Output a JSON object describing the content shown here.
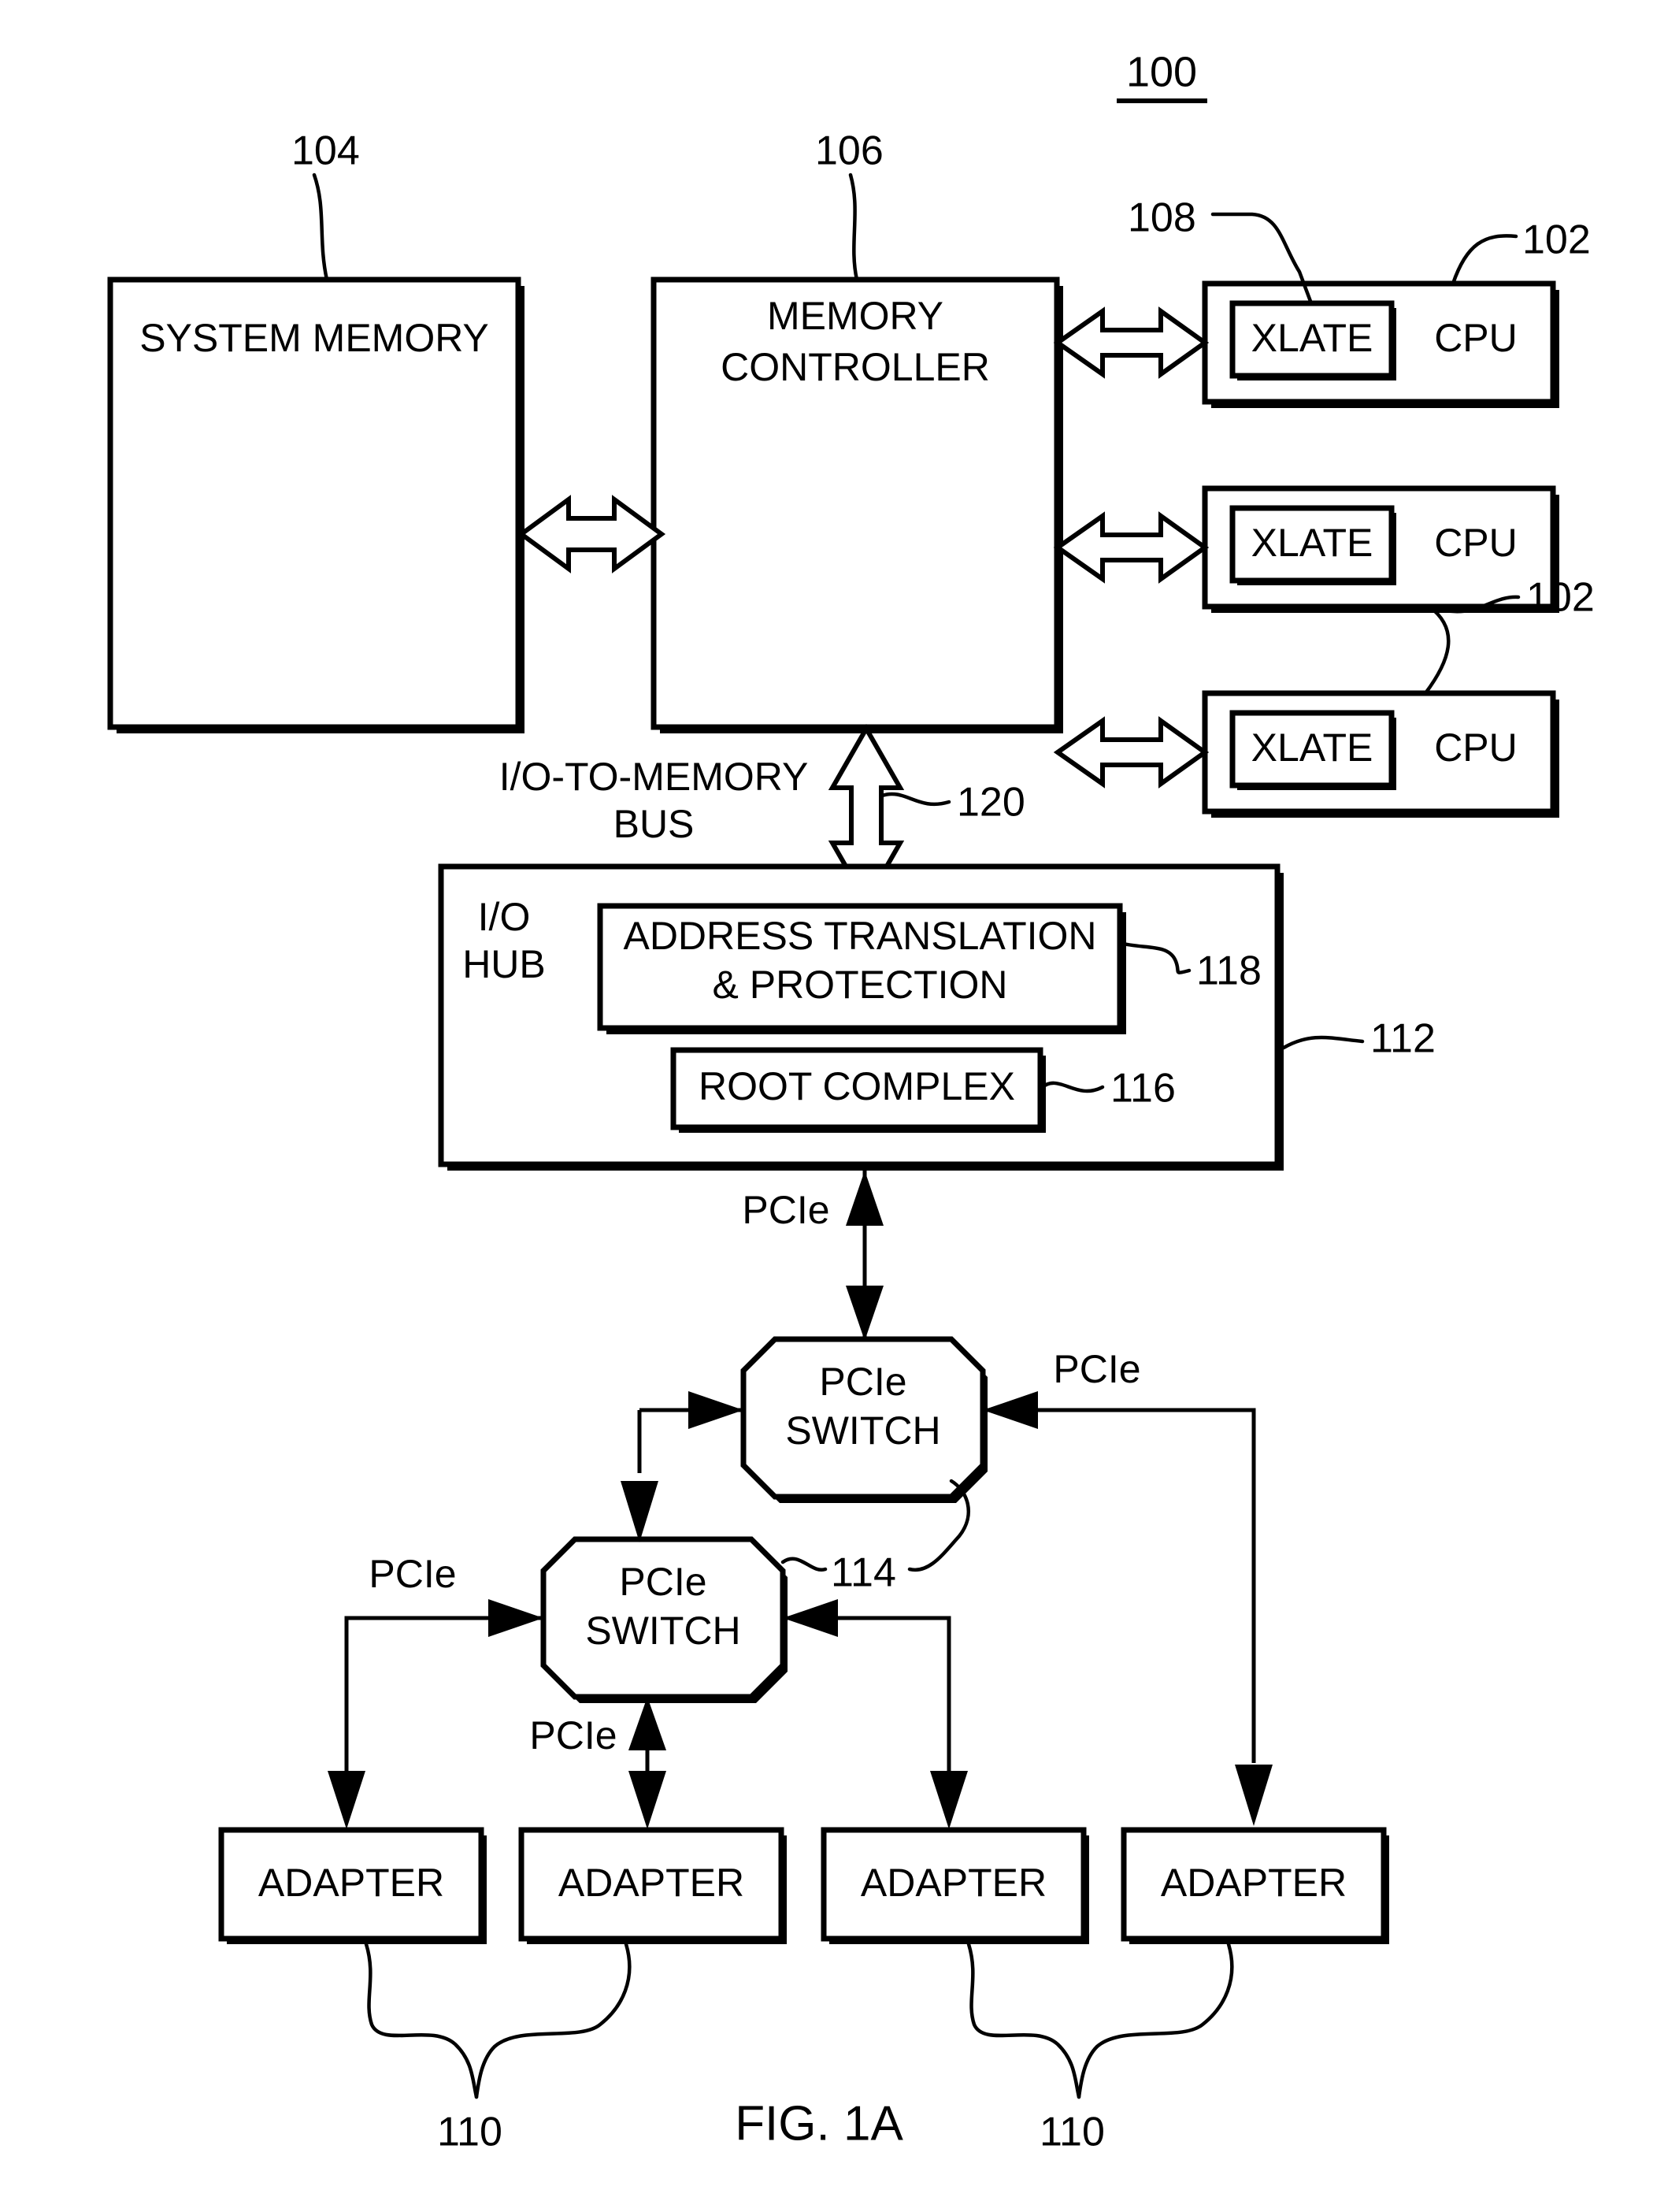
{
  "figure": {
    "number_label": "100",
    "caption": "FIG. 1A"
  },
  "blocks": {
    "system_memory": "SYSTEM MEMORY",
    "memory_controller_line1": "MEMORY",
    "memory_controller_line2": "CONTROLLER",
    "io_hub_line1": "I/O",
    "io_hub_line2": "HUB",
    "address_translation_line1": "ADDRESS TRANSLATION",
    "address_translation_line2": "& PROTECTION",
    "root_complex": "ROOT COMPLEX",
    "xlate": "XLATE",
    "cpu": "CPU",
    "pcie_switch_line1": "PCIe",
    "pcie_switch_line2": "SWITCH",
    "adapter": "ADAPTER"
  },
  "cpus": [
    {
      "xlate": "XLATE",
      "cpu": "CPU"
    },
    {
      "xlate": "XLATE",
      "cpu": "CPU"
    },
    {
      "xlate": "XLATE",
      "cpu": "CPU"
    }
  ],
  "adapters": [
    {
      "label": "ADAPTER"
    },
    {
      "label": "ADAPTER"
    },
    {
      "label": "ADAPTER"
    },
    {
      "label": "ADAPTER"
    }
  ],
  "switches": [
    {
      "line1": "PCIe",
      "line2": "SWITCH"
    },
    {
      "line1": "PCIe",
      "line2": "SWITCH"
    }
  ],
  "bus_labels": {
    "io_to_memory_line1": "I/O-TO-MEMORY",
    "io_to_memory_line2": "BUS",
    "pcie_hub_to_switch": "PCIe",
    "pcie_upper_right": "PCIe",
    "pcie_lower_left": "PCIe",
    "pcie_lower_bottom": "PCIe"
  },
  "reference_numerals": {
    "system": "100",
    "cpu_top": "102",
    "cpu_mid": "102",
    "system_memory": "104",
    "memory_controller": "106",
    "xlate": "108",
    "adapters_left": "110",
    "adapters_right": "110",
    "io_hub": "112",
    "pcie_switch": "114",
    "root_complex": "116",
    "address_translation": "118",
    "io_memory_bus": "120"
  },
  "colors": {
    "ink": "#000000",
    "paper": "#ffffff"
  }
}
